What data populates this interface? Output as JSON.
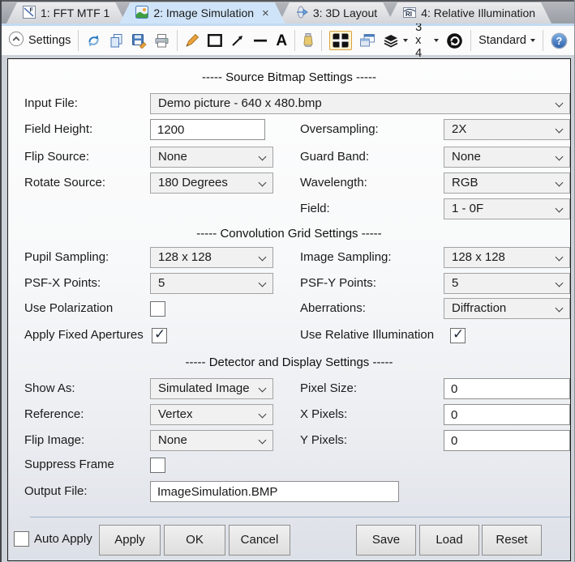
{
  "window": {
    "tabs": [
      {
        "label": "1: FFT MTF 1"
      },
      {
        "label": "2: Image Simulation",
        "close": "×"
      },
      {
        "label": "3: 3D Layout"
      },
      {
        "label": "4: Relative Illumination"
      }
    ]
  },
  "toolbar": {
    "settings_label": "Settings",
    "text_tool_glyph": "A",
    "grid_size": "3 x 4",
    "display_mode": "Standard",
    "help_glyph": "?"
  },
  "source": {
    "title": "----- Source Bitmap Settings -----",
    "input_file": {
      "label": "Input File:",
      "value": "Demo picture -  640 x 480.bmp"
    },
    "field_height": {
      "label": "Field Height:",
      "value": "1200"
    },
    "oversampling": {
      "label": "Oversampling:",
      "value": "2X"
    },
    "flip_source": {
      "label": "Flip Source:",
      "value": "None"
    },
    "guard_band": {
      "label": "Guard Band:",
      "value": "None"
    },
    "rotate_source": {
      "label": "Rotate Source:",
      "value": "180 Degrees"
    },
    "wavelength": {
      "label": "Wavelength:",
      "value": "RGB"
    },
    "field": {
      "label": "Field:",
      "value": "1 - 0F"
    }
  },
  "convolution": {
    "title": "----- Convolution Grid Settings -----",
    "pupil_sampling": {
      "label": "Pupil Sampling:",
      "value": "128 x 128"
    },
    "image_sampling": {
      "label": "Image Sampling:",
      "value": "128 x 128"
    },
    "psf_x": {
      "label": "PSF-X Points:",
      "value": "5"
    },
    "psf_y": {
      "label": "PSF-Y Points:",
      "value": "5"
    },
    "use_polarization": {
      "label": "Use Polarization",
      "checked": false,
      "mark": ""
    },
    "aberrations": {
      "label": "Aberrations:",
      "value": "Diffraction"
    },
    "apply_fixed_apertures": {
      "label": "Apply Fixed Apertures",
      "checked": true,
      "mark": "✓"
    },
    "use_relative_illumination": {
      "label": "Use Relative Illumination",
      "checked": true,
      "mark": "✓"
    }
  },
  "detector": {
    "title": "----- Detector and Display Settings -----",
    "show_as": {
      "label": "Show As:",
      "value": "Simulated Image"
    },
    "pixel_size": {
      "label": "Pixel Size:",
      "value": "0"
    },
    "reference": {
      "label": "Reference:",
      "value": "Vertex"
    },
    "x_pixels": {
      "label": "X Pixels:",
      "value": "0"
    },
    "flip_image": {
      "label": "Flip Image:",
      "value": "None"
    },
    "y_pixels": {
      "label": "Y Pixels:",
      "value": "0"
    },
    "suppress_frame": {
      "label": "Suppress Frame",
      "checked": false,
      "mark": ""
    },
    "output_file": {
      "label": "Output File:",
      "value": "ImageSimulation.BMP"
    }
  },
  "footer": {
    "auto_apply": {
      "label": "Auto Apply",
      "checked": false,
      "mark": ""
    },
    "apply": "Apply",
    "ok": "OK",
    "cancel": "Cancel",
    "save": "Save",
    "load": "Load",
    "reset": "Reset"
  },
  "colors": {
    "active_tab": "#cfe4f8",
    "toolbar_highlight_bg": "#fdf3d1",
    "toolbar_highlight_border": "#d9a33c",
    "panel_border": "#1c1c1c",
    "divider": "#9cb3cb"
  }
}
